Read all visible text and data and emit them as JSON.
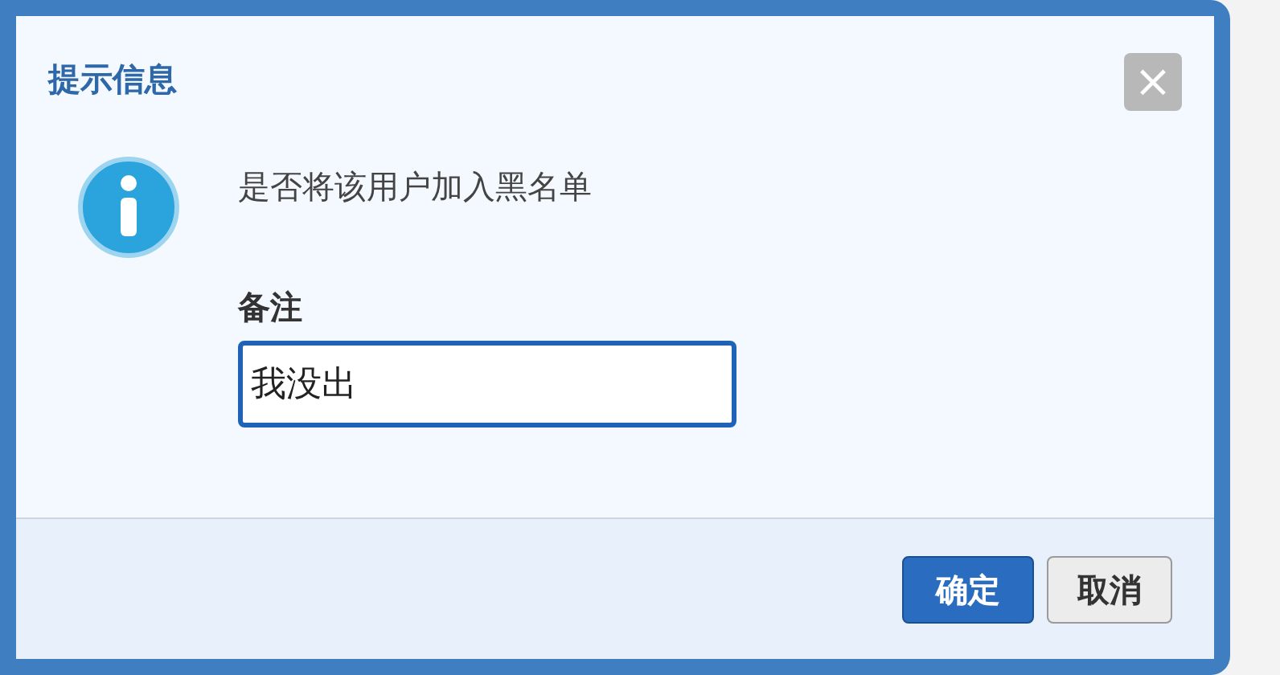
{
  "dialog": {
    "title": "提示信息",
    "close": "×",
    "message": "是否将该用户加入黑名单",
    "note": {
      "label": "备注",
      "value": "我没出"
    },
    "buttons": [
      {
        "label": "确定",
        "kind": "primary"
      },
      {
        "label": "取消",
        "kind": "secondary"
      }
    ]
  }
}
